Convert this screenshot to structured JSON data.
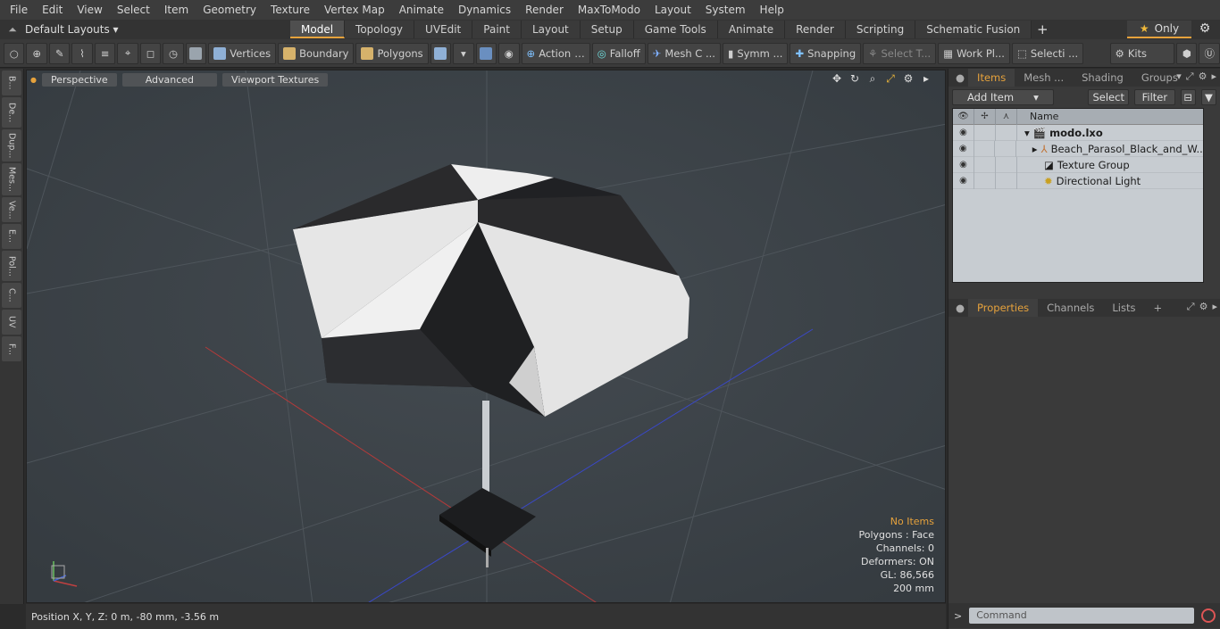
{
  "menu": [
    "File",
    "Edit",
    "View",
    "Select",
    "Item",
    "Geometry",
    "Texture",
    "Vertex Map",
    "Animate",
    "Dynamics",
    "Render",
    "MaxToModo",
    "Layout",
    "System",
    "Help"
  ],
  "layouts": {
    "label": "Default Layouts ▾"
  },
  "tabs": [
    "Model",
    "Topology",
    "UVEdit",
    "Paint",
    "Layout",
    "Setup",
    "Game Tools",
    "Animate",
    "Render",
    "Scripting",
    "Schematic Fusion"
  ],
  "active_tab": "Model",
  "only": {
    "label": "Only"
  },
  "toolbar": {
    "vertices": "Vertices",
    "boundary": "Boundary",
    "polygons": "Polygons",
    "action": "Action",
    "falloff": "Falloff",
    "meshc": "Mesh C ...",
    "symm": "Symm ...",
    "snapping": "Snapping",
    "selectt": "Select T...",
    "workpl": "Work Pl...",
    "selecti": "Selecti ...",
    "kits": "Kits"
  },
  "leftstrip": [
    "B...",
    "De...",
    "Dup...",
    "Mes...",
    "Ve...",
    "E...",
    "Pol...",
    "C...",
    "UV",
    "F..."
  ],
  "viewport": {
    "perspective": "Perspective",
    "advanced": "Advanced",
    "textures": "Viewport Textures",
    "stats": {
      "items": "No Items",
      "polygons": "Polygons : Face",
      "channels": "Channels: 0",
      "deformers": "Deformers: ON",
      "gl": "GL: 86,566",
      "scale": "200 mm"
    }
  },
  "status": {
    "position": "Position X, Y, Z:   0 m, -80 mm, -3.56 m"
  },
  "panel": {
    "tabs": [
      "Items",
      "Mesh ...",
      "Shading",
      "Groups"
    ],
    "add_item": "Add Item",
    "select": "Select",
    "filter": "Filter",
    "name_col": "Name",
    "tree": [
      {
        "name": "modo.lxo",
        "icon": "scene-icon"
      },
      {
        "name": "Beach_Parasol_Black_and_W...",
        "icon": "mesh-icon"
      },
      {
        "name": "Texture Group",
        "icon": "texture-icon"
      },
      {
        "name": "Directional Light",
        "icon": "light-icon"
      }
    ],
    "props_tabs": [
      "Properties",
      "Channels",
      "Lists"
    ]
  },
  "command": {
    "placeholder": "Command"
  }
}
